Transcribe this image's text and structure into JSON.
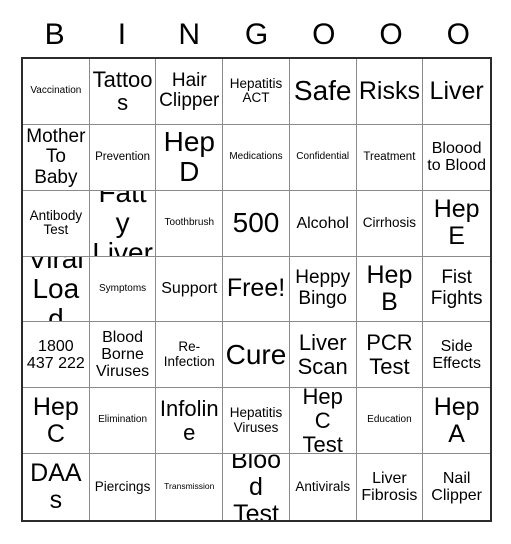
{
  "card": {
    "title_letters": [
      "B",
      "I",
      "N",
      "G",
      "O",
      "O",
      "O"
    ],
    "columns": 7,
    "rows": 7,
    "border_color": "#2b2b2b",
    "grid_line_color": "#8a8a8a",
    "background_color": "#ffffff",
    "text_color": "#000000",
    "free_space_label": "Free!",
    "free_space_index": {
      "row": 3,
      "col": 3
    }
  },
  "cells": [
    {
      "text": "Vaccination",
      "size": "s-xs"
    },
    {
      "text": "Tattoos",
      "size": "s-2xl"
    },
    {
      "text": "Hair Clipper",
      "size": "s-xl"
    },
    {
      "text": "Hepatitis ACT",
      "size": "s-md"
    },
    {
      "text": "Safe",
      "size": "s-4xl"
    },
    {
      "text": "Risks",
      "size": "s-3xl"
    },
    {
      "text": "Liver",
      "size": "s-3xl"
    },
    {
      "text": "Mother To Baby",
      "size": "s-xl"
    },
    {
      "text": "Prevention",
      "size": "s-sm"
    },
    {
      "text": "Hep D",
      "size": "s-4xl"
    },
    {
      "text": "Medications",
      "size": "s-xs"
    },
    {
      "text": "Confidential",
      "size": "s-xs"
    },
    {
      "text": "Treatment",
      "size": "s-sm"
    },
    {
      "text": "Bloood to Blood",
      "size": "s-lg"
    },
    {
      "text": "Antibody Test",
      "size": "s-md"
    },
    {
      "text": "Fatty Liver",
      "size": "s-4xl"
    },
    {
      "text": "Toothbrush",
      "size": "s-xs"
    },
    {
      "text": "500",
      "size": "s-4xl"
    },
    {
      "text": "Alcohol",
      "size": "s-lg"
    },
    {
      "text": "Cirrhosis",
      "size": "s-md"
    },
    {
      "text": "Hep E",
      "size": "s-3xl"
    },
    {
      "text": "Viral Load",
      "size": "s-4xl"
    },
    {
      "text": "Symptoms",
      "size": "s-xs"
    },
    {
      "text": "Support",
      "size": "s-lg"
    },
    {
      "text": "Free!",
      "size": "s-3xl"
    },
    {
      "text": "Heppy Bingo",
      "size": "s-xl"
    },
    {
      "text": "Hep B",
      "size": "s-3xl"
    },
    {
      "text": "Fist Fights",
      "size": "s-xl"
    },
    {
      "text": "1800 437 222",
      "size": "s-lg"
    },
    {
      "text": "Blood Borne Viruses",
      "size": "s-lg"
    },
    {
      "text": "Re-Infection",
      "size": "s-md"
    },
    {
      "text": "Cure",
      "size": "s-4xl"
    },
    {
      "text": "Liver Scan",
      "size": "s-2xl"
    },
    {
      "text": "PCR Test",
      "size": "s-2xl"
    },
    {
      "text": "Side Effects",
      "size": "s-lg"
    },
    {
      "text": "Hep C",
      "size": "s-3xl"
    },
    {
      "text": "Elimination",
      "size": "s-xs"
    },
    {
      "text": "Infoline",
      "size": "s-2xl"
    },
    {
      "text": "Hepatitis Viruses",
      "size": "s-md"
    },
    {
      "text": "Hep C Test",
      "size": "s-2xl"
    },
    {
      "text": "Education",
      "size": "s-xs"
    },
    {
      "text": "Hep A",
      "size": "s-3xl"
    },
    {
      "text": "DAAs",
      "size": "s-3xl"
    },
    {
      "text": "Piercings",
      "size": "s-md"
    },
    {
      "text": "Transmission",
      "size": "s-xxs"
    },
    {
      "text": "Blood Test",
      "size": "s-3xl"
    },
    {
      "text": "Antivirals",
      "size": "s-md"
    },
    {
      "text": "Liver Fibrosis",
      "size": "s-lg"
    },
    {
      "text": "Nail Clipper",
      "size": "s-lg"
    }
  ]
}
